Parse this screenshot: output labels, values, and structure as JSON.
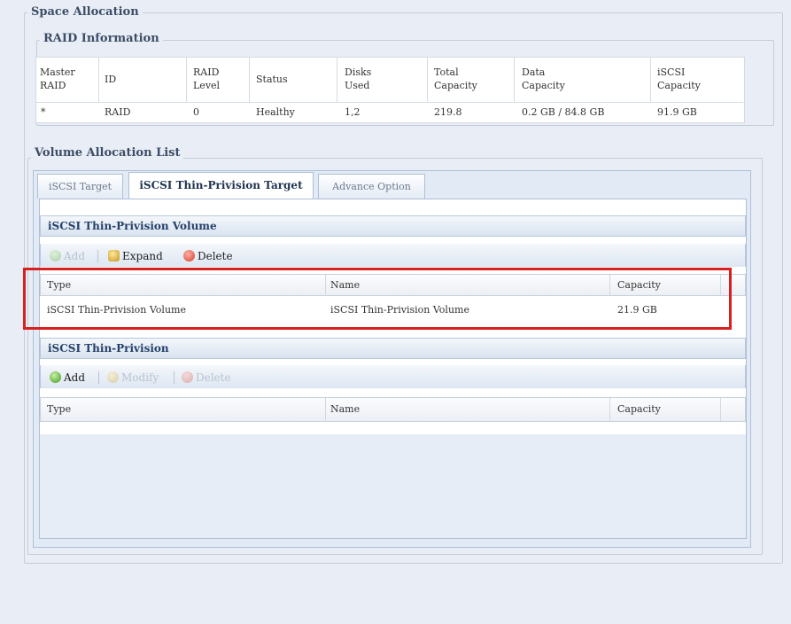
{
  "space_allocation": {
    "legend": "Space Allocation"
  },
  "raid_information": {
    "legend": "RAID Information",
    "headers": [
      [
        "Master",
        "RAID"
      ],
      [
        "ID",
        ""
      ],
      [
        "RAID",
        "Level"
      ],
      [
        "Status",
        ""
      ],
      [
        "Disks",
        "Used"
      ],
      [
        "Total",
        "Capacity"
      ],
      [
        "Data",
        "Capacity"
      ],
      [
        "iSCSI",
        "Capacity"
      ]
    ],
    "row": [
      "*",
      "RAID",
      "0",
      "Healthy",
      "1,2",
      "219.8",
      "0.2 GB / 84.8 GB",
      "91.9 GB"
    ]
  },
  "volume_allocation": {
    "legend": "Volume Allocation List",
    "tabs": [
      "iSCSI Target",
      "iSCSI Thin-Privision Target",
      "Advance Option"
    ],
    "active_tab": "iSCSI Thin-Privision Target"
  },
  "thin_volume_panel": {
    "title": "iSCSI Thin-Privision Volume",
    "toolbar": {
      "add": "Add",
      "expand": "Expand",
      "delete": "Delete"
    },
    "columns": [
      "Type",
      "Name",
      "Capacity"
    ],
    "rows": [
      {
        "type": "iSCSI Thin-Privision Volume",
        "name": "iSCSI Thin-Privision Volume",
        "capacity": "21.9 GB"
      }
    ]
  },
  "thin_target_panel": {
    "title": "iSCSI Thin-Privision",
    "toolbar": {
      "add": "Add",
      "modify": "Modify",
      "delete": "Delete"
    },
    "columns": [
      "Type",
      "Name",
      "Capacity"
    ]
  },
  "colors": {
    "highlight_border": "#d82020",
    "panel_header_text": "#25406a",
    "background": "#e9eef6"
  }
}
